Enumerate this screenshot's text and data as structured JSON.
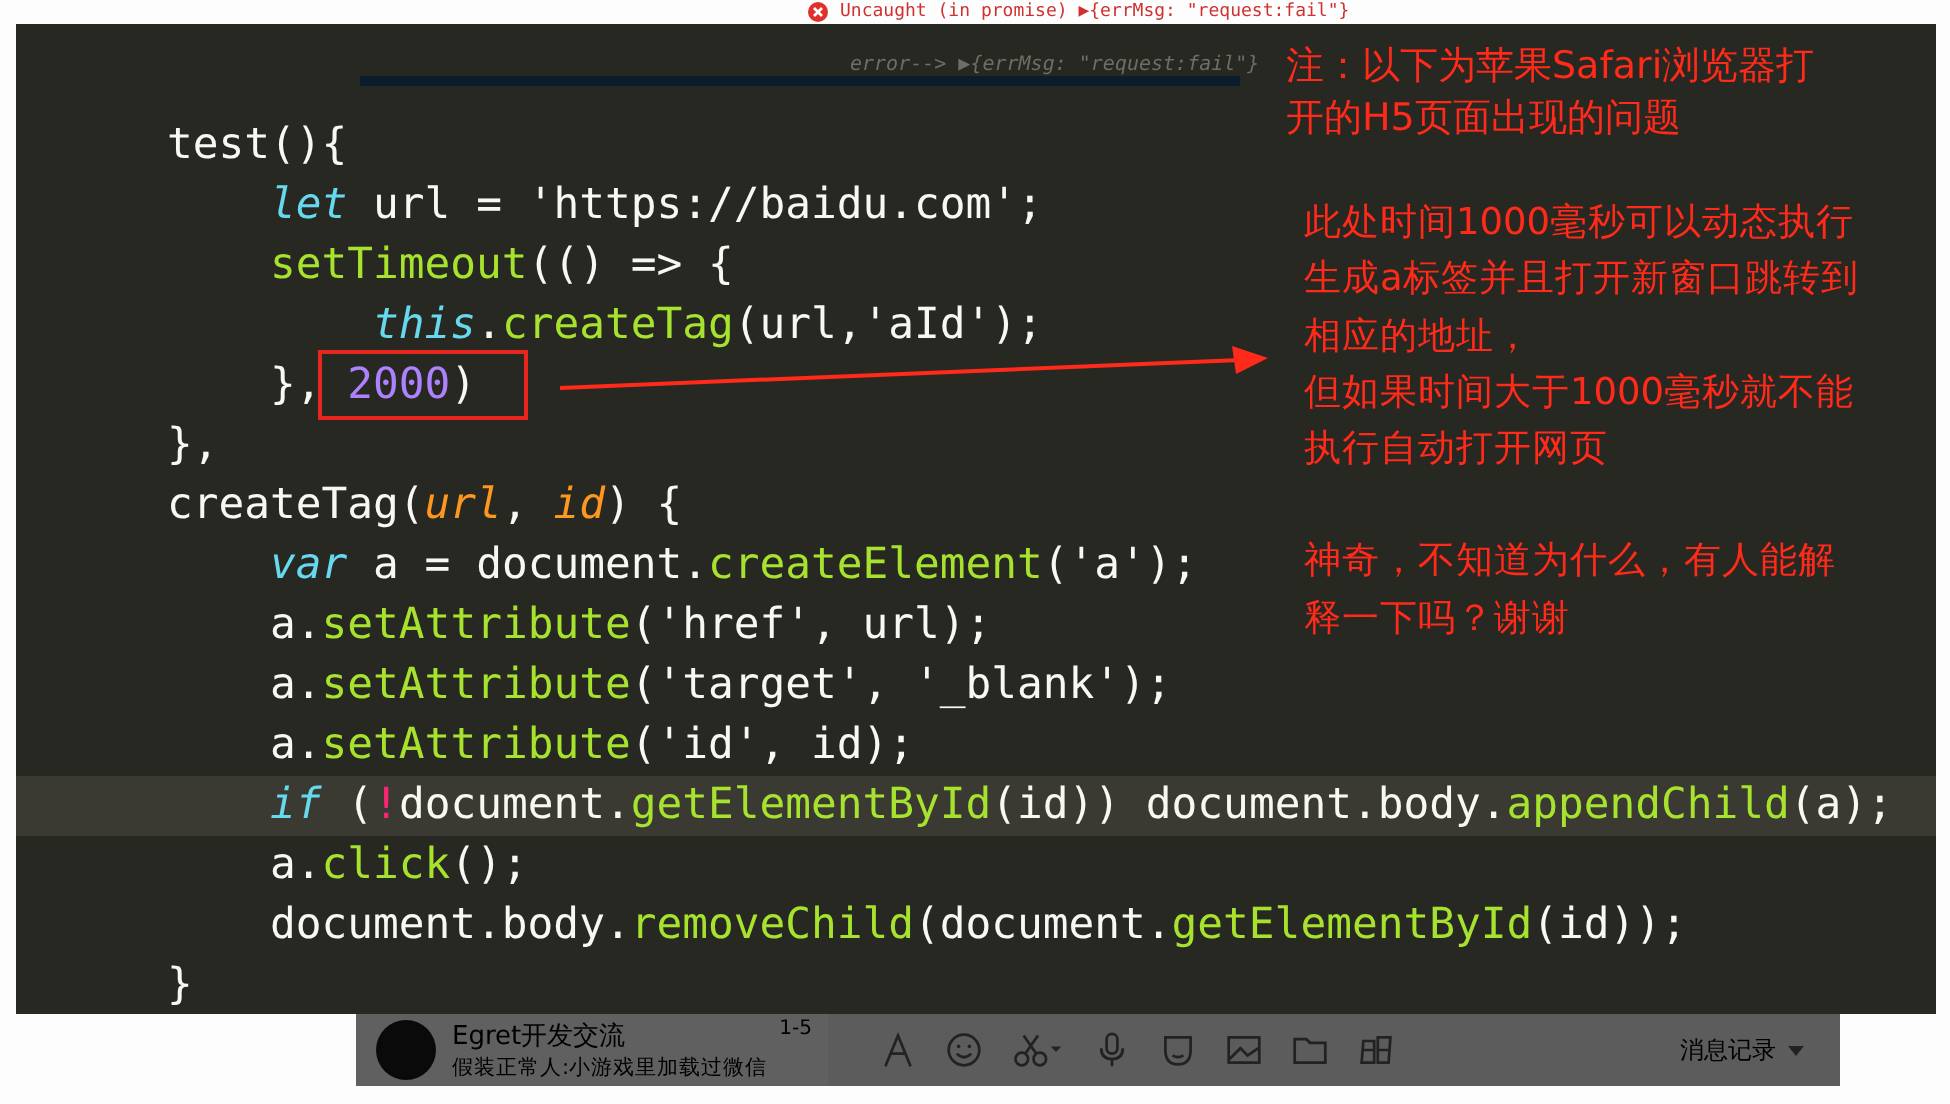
{
  "console": {
    "error_line": "Uncaught (in promise) ▶{errMsg: \"request:fail\"}",
    "log_line": "error--> ▶{errMsg: \"request:fail\"}"
  },
  "editor": {
    "lines": [
      {
        "selected": false,
        "tokens": [
          {
            "kind": "plain",
            "text": "    test(){"
          }
        ]
      },
      {
        "selected": false,
        "tokens": [
          {
            "kind": "keyword",
            "text": "        let"
          },
          {
            "kind": "plain",
            "text": " url = 'https://baidu.com';"
          }
        ]
      },
      {
        "selected": false,
        "tokens": [
          {
            "kind": "function",
            "text": "        setTimeout"
          },
          {
            "kind": "plain",
            "text": "(() => {"
          }
        ]
      },
      {
        "selected": false,
        "tokens": [
          {
            "kind": "keyword",
            "text": "            this"
          },
          {
            "kind": "plain",
            "text": "."
          },
          {
            "kind": "function",
            "text": "createTag"
          },
          {
            "kind": "plain",
            "text": "(url,'aId');"
          }
        ]
      },
      {
        "selected": false,
        "tokens": [
          {
            "kind": "plain",
            "text": "        },"
          },
          {
            "kind": "box",
            "tokens": [
              {
                "kind": "number",
                "text": " 2000"
              },
              {
                "kind": "plain",
                "text": ")"
              }
            ]
          }
        ]
      },
      {
        "selected": false,
        "tokens": [
          {
            "kind": "plain",
            "text": "    },"
          }
        ]
      },
      {
        "selected": false,
        "tokens": [
          {
            "kind": "plain",
            "text": "    createTag("
          },
          {
            "kind": "param",
            "text": "url"
          },
          {
            "kind": "plain",
            "text": ", "
          },
          {
            "kind": "param",
            "text": "id"
          },
          {
            "kind": "plain",
            "text": ") {"
          }
        ]
      },
      {
        "selected": false,
        "tokens": [
          {
            "kind": "keyword",
            "text": "        var"
          },
          {
            "kind": "plain",
            "text": " a = document."
          },
          {
            "kind": "function",
            "text": "createElement"
          },
          {
            "kind": "plain",
            "text": "('a');"
          }
        ]
      },
      {
        "selected": false,
        "tokens": [
          {
            "kind": "plain",
            "text": "        a."
          },
          {
            "kind": "function",
            "text": "setAttribute"
          },
          {
            "kind": "plain",
            "text": "('href', url);"
          }
        ]
      },
      {
        "selected": false,
        "tokens": [
          {
            "kind": "plain",
            "text": "        a."
          },
          {
            "kind": "function",
            "text": "setAttribute"
          },
          {
            "kind": "plain",
            "text": "('target', '_blank');"
          }
        ]
      },
      {
        "selected": false,
        "tokens": [
          {
            "kind": "plain",
            "text": "        a."
          },
          {
            "kind": "function",
            "text": "setAttribute"
          },
          {
            "kind": "plain",
            "text": "('id', id);"
          }
        ]
      },
      {
        "selected": true,
        "tokens": [
          {
            "kind": "keyword",
            "text": "        if"
          },
          {
            "kind": "plain",
            "text": " ("
          },
          {
            "kind": "operator",
            "text": "!"
          },
          {
            "kind": "plain",
            "text": "document."
          },
          {
            "kind": "function",
            "text": "getElementById"
          },
          {
            "kind": "plain",
            "text": "(id)) document.body."
          },
          {
            "kind": "function",
            "text": "appendChild"
          },
          {
            "kind": "plain",
            "text": "(a);"
          }
        ]
      },
      {
        "selected": false,
        "tokens": [
          {
            "kind": "plain",
            "text": "        a."
          },
          {
            "kind": "function",
            "text": "click"
          },
          {
            "kind": "plain",
            "text": "();"
          }
        ]
      },
      {
        "selected": false,
        "tokens": [
          {
            "kind": "plain",
            "text": "        document.body."
          },
          {
            "kind": "function",
            "text": "removeChild"
          },
          {
            "kind": "plain",
            "text": "(document."
          },
          {
            "kind": "function",
            "text": "getElementById"
          },
          {
            "kind": "plain",
            "text": "(id));"
          }
        ]
      },
      {
        "selected": false,
        "tokens": [
          {
            "kind": "plain",
            "text": "    }"
          }
        ]
      }
    ]
  },
  "notes": [
    {
      "kind": "title",
      "lines": [
        "注：以下为苹果Safari浏览器打",
        "开的H5页面出现的问题"
      ]
    },
    {
      "kind": "body",
      "paragraphs": [
        [
          "此处时间1000毫秒可以动态执行",
          "生成a标签并且打开新窗口跳转到",
          "相应的地址，",
          "但如果时间大于1000毫秒就不能",
          "执行自动打开网页"
        ],
        [
          "神奇，不知道为什么，有人能解",
          "释一下吗？谢谢"
        ]
      ]
    }
  ],
  "chat": {
    "name": "Egret开发交流",
    "time": "1-5",
    "preview": "假装正常人:小游戏里加载过微信",
    "history_label": "消息记录"
  }
}
